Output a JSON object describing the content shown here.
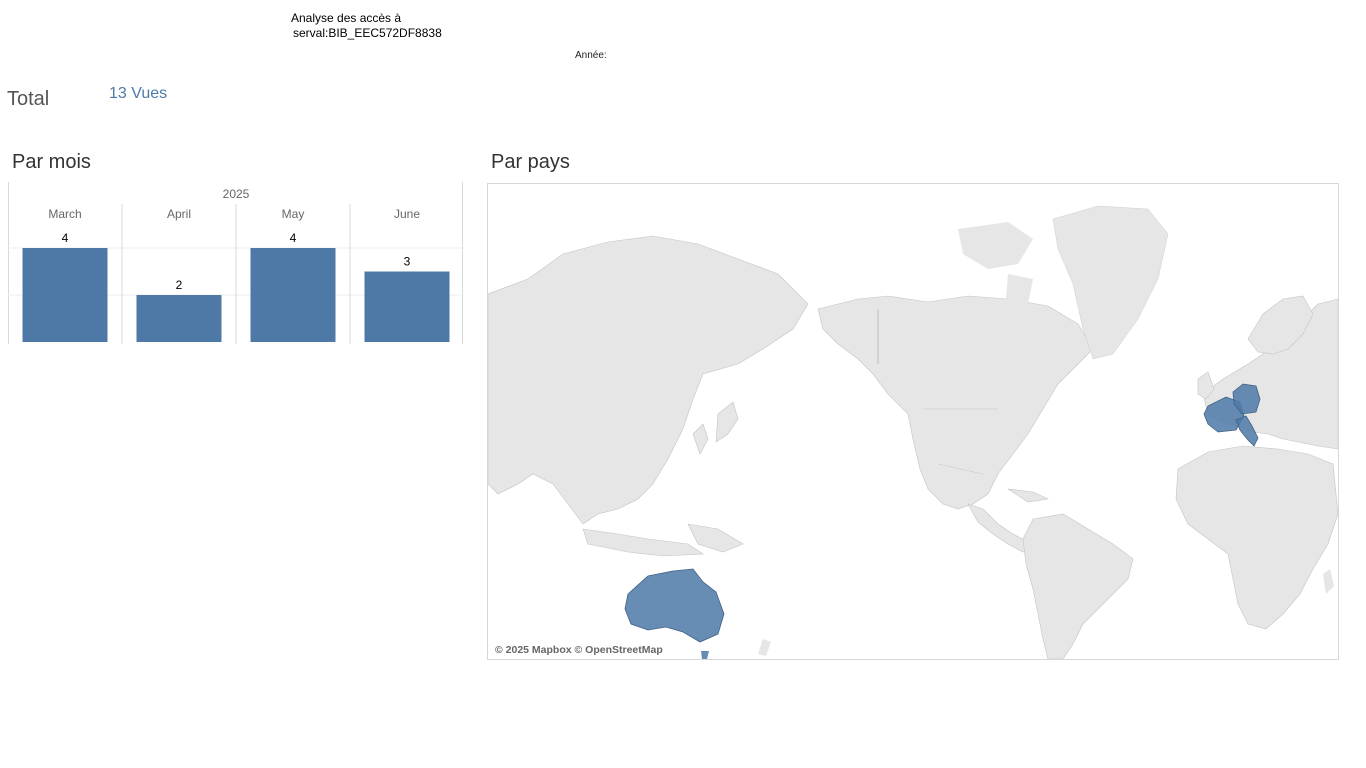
{
  "header": {
    "title_line1": "Analyse des accès à",
    "title_line2": "serval:BIB_EEC572DF8838",
    "year_filter_label": "Année:"
  },
  "summary": {
    "label": "Total",
    "value": "13 Vues"
  },
  "sections": {
    "monthly": "Par mois",
    "country": "Par pays"
  },
  "chart_data": {
    "type": "bar",
    "title": "",
    "year": "2025",
    "categories": [
      "March",
      "April",
      "May",
      "June"
    ],
    "values": [
      4,
      2,
      4,
      3
    ],
    "ylim": [
      0,
      4
    ],
    "grid": true,
    "bar_color": "#4e79a7"
  },
  "map": {
    "credit": "© 2025 Mapbox © OpenStreetMap",
    "highlighted_countries": [
      "Australia",
      "France",
      "Germany",
      "Italy"
    ],
    "land_color": "#e6e6e6",
    "highlight_color": "#4e79a7"
  }
}
